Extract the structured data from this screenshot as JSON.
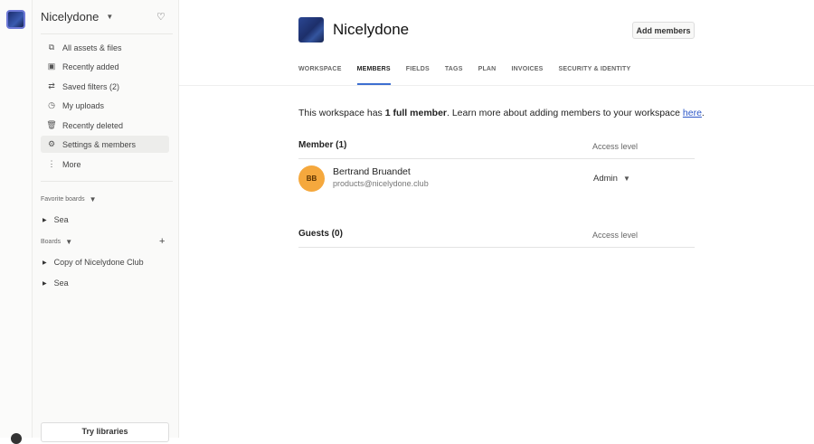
{
  "workspace": {
    "name": "Nicelydone"
  },
  "sidebar": {
    "items": [
      {
        "label": "All assets & files",
        "icon": "assets-icon"
      },
      {
        "label": "Recently added",
        "icon": "recently-added-icon"
      },
      {
        "label": "Saved filters (2)",
        "icon": "filters-icon"
      },
      {
        "label": "My uploads",
        "icon": "clock-icon"
      },
      {
        "label": "Recently deleted",
        "icon": "trash-icon"
      },
      {
        "label": "Settings & members",
        "icon": "gear-icon"
      },
      {
        "label": "More",
        "icon": "more-icon"
      }
    ],
    "favorites_label": "Favorite boards",
    "favorites": [
      "Sea"
    ],
    "boards_label": "Boards",
    "boards": [
      "Copy of Nicelydone Club",
      "Sea"
    ],
    "try_libraries": "Try libraries"
  },
  "header": {
    "title": "Nicelydone",
    "add_members": "Add members",
    "tabs": [
      "WORKSPACE",
      "MEMBERS",
      "FIELDS",
      "TAGS",
      "PLAN",
      "INVOICES",
      "SECURITY & IDENTITY"
    ],
    "active_tab": "MEMBERS"
  },
  "intro": {
    "pre": "This workspace has ",
    "bold": "1 full member",
    "post": ". Learn more about adding members to your workspace ",
    "link": "here",
    "end": "."
  },
  "members": {
    "heading": "Member (1)",
    "access_label": "Access level",
    "list": [
      {
        "initials": "BB",
        "name": "Bertrand Bruandet",
        "email": "products@nicelydone.club",
        "role": "Admin"
      }
    ]
  },
  "guests": {
    "heading": "Guests (0)",
    "access_label": "Access level"
  },
  "colors": {
    "accent": "#3d6fd1",
    "avatar": "#f5a83d"
  }
}
